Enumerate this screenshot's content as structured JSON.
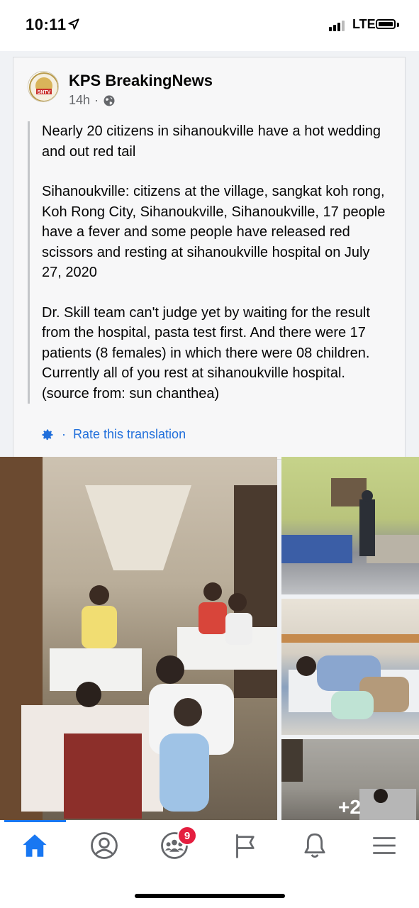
{
  "status_bar": {
    "time": "10:11",
    "network": "LTE"
  },
  "post": {
    "page_name": "KPS BreakingNews",
    "time_ago": "14h",
    "separator": "·",
    "avatar_logo_text": "SNTV",
    "paragraphs": [
      "Nearly 20 citizens in sihanoukville have a hot wedding and out red tail",
      "Sihanoukville: citizens at the village, sangkat koh rong, Koh Rong City, Sihanoukville, Sihanoukville, 17 people have a fever and some people have released red scissors and resting at sihanoukville hospital on July 27, 2020",
      "Dr. Skill team can't judge yet by waiting for the result from the hospital, pasta test first. And there were 17 patients (8 females) in which there were 08 children.\nCurrently all of you rest at sihanoukville hospital. (source from: sun chanthea)"
    ],
    "rate_translation": "Rate this translation",
    "more_photos": "+2"
  },
  "tab_bar": {
    "groups_badge": "9"
  },
  "colors": {
    "accent": "#1877f2",
    "link": "#216fdb",
    "badge": "#e41e3f"
  }
}
